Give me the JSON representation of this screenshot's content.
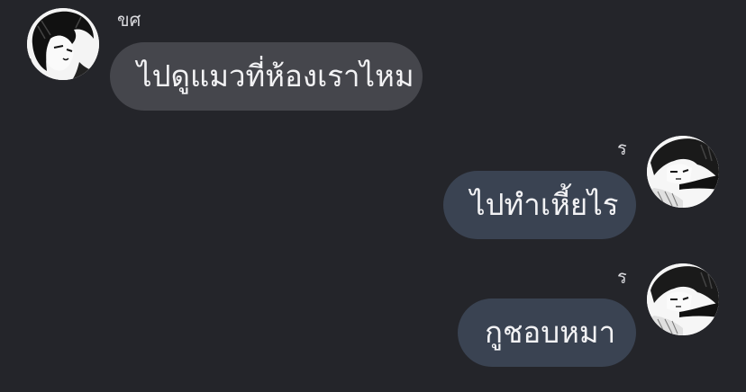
{
  "messages": [
    {
      "direction": "incoming",
      "sender": "ขศ",
      "text": "ไปดูแมวที่ห้องเราไหม",
      "avatar_icon": "manga-boy-avatar-icon"
    },
    {
      "direction": "outgoing",
      "sender": "ร",
      "text": "ไปทำเหี้ยไร",
      "avatar_icon": "manga-girl-avatar-icon"
    },
    {
      "direction": "outgoing",
      "sender": "ร",
      "text": "กูชอบหมา",
      "avatar_icon": "manga-girl-avatar-icon"
    }
  ],
  "colors": {
    "background": "#24252a",
    "incoming_bubble": "#45464c",
    "outgoing_bubble": "#3a4352",
    "text": "#f2f2f4"
  }
}
